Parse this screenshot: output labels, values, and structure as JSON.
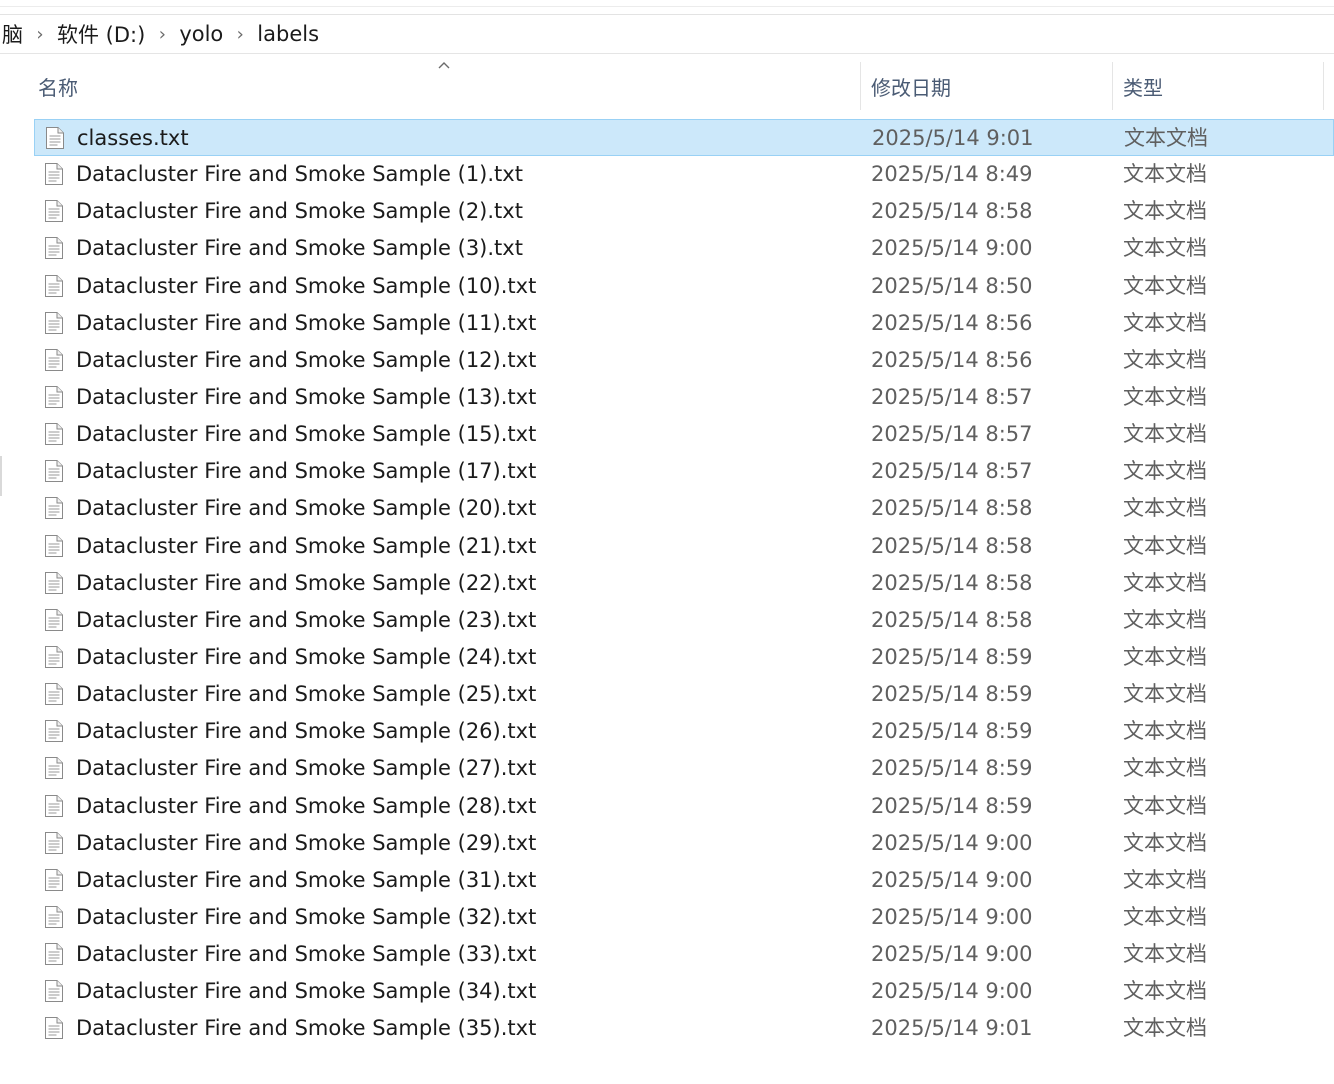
{
  "breadcrumb": {
    "items": [
      "脑",
      "软件 (D:)",
      "yolo",
      "labels"
    ],
    "separator_icon": "chevron-right-icon"
  },
  "columns": {
    "name": "名称",
    "date": "修改日期",
    "type": "类型",
    "sort_indicator": "sort-ascending-icon"
  },
  "files": [
    {
      "name": "classes.txt",
      "date": "2025/5/14 9:01",
      "type": "文本文档",
      "selected": true
    },
    {
      "name": "Datacluster Fire and Smoke Sample (1).txt",
      "date": "2025/5/14 8:49",
      "type": "文本文档"
    },
    {
      "name": "Datacluster Fire and Smoke Sample (2).txt",
      "date": "2025/5/14 8:58",
      "type": "文本文档"
    },
    {
      "name": "Datacluster Fire and Smoke Sample (3).txt",
      "date": "2025/5/14 9:00",
      "type": "文本文档"
    },
    {
      "name": "Datacluster Fire and Smoke Sample (10).txt",
      "date": "2025/5/14 8:50",
      "type": "文本文档"
    },
    {
      "name": "Datacluster Fire and Smoke Sample (11).txt",
      "date": "2025/5/14 8:56",
      "type": "文本文档"
    },
    {
      "name": "Datacluster Fire and Smoke Sample (12).txt",
      "date": "2025/5/14 8:56",
      "type": "文本文档"
    },
    {
      "name": "Datacluster Fire and Smoke Sample (13).txt",
      "date": "2025/5/14 8:57",
      "type": "文本文档"
    },
    {
      "name": "Datacluster Fire and Smoke Sample (15).txt",
      "date": "2025/5/14 8:57",
      "type": "文本文档"
    },
    {
      "name": "Datacluster Fire and Smoke Sample (17).txt",
      "date": "2025/5/14 8:57",
      "type": "文本文档"
    },
    {
      "name": "Datacluster Fire and Smoke Sample (20).txt",
      "date": "2025/5/14 8:58",
      "type": "文本文档"
    },
    {
      "name": "Datacluster Fire and Smoke Sample (21).txt",
      "date": "2025/5/14 8:58",
      "type": "文本文档"
    },
    {
      "name": "Datacluster Fire and Smoke Sample (22).txt",
      "date": "2025/5/14 8:58",
      "type": "文本文档"
    },
    {
      "name": "Datacluster Fire and Smoke Sample (23).txt",
      "date": "2025/5/14 8:58",
      "type": "文本文档"
    },
    {
      "name": "Datacluster Fire and Smoke Sample (24).txt",
      "date": "2025/5/14 8:59",
      "type": "文本文档"
    },
    {
      "name": "Datacluster Fire and Smoke Sample (25).txt",
      "date": "2025/5/14 8:59",
      "type": "文本文档"
    },
    {
      "name": "Datacluster Fire and Smoke Sample (26).txt",
      "date": "2025/5/14 8:59",
      "type": "文本文档"
    },
    {
      "name": "Datacluster Fire and Smoke Sample (27).txt",
      "date": "2025/5/14 8:59",
      "type": "文本文档"
    },
    {
      "name": "Datacluster Fire and Smoke Sample (28).txt",
      "date": "2025/5/14 8:59",
      "type": "文本文档"
    },
    {
      "name": "Datacluster Fire and Smoke Sample (29).txt",
      "date": "2025/5/14 9:00",
      "type": "文本文档"
    },
    {
      "name": "Datacluster Fire and Smoke Sample (31).txt",
      "date": "2025/5/14 9:00",
      "type": "文本文档"
    },
    {
      "name": "Datacluster Fire and Smoke Sample (32).txt",
      "date": "2025/5/14 9:00",
      "type": "文本文档"
    },
    {
      "name": "Datacluster Fire and Smoke Sample (33).txt",
      "date": "2025/5/14 9:00",
      "type": "文本文档"
    },
    {
      "name": "Datacluster Fire and Smoke Sample (34).txt",
      "date": "2025/5/14 9:00",
      "type": "文本文档"
    },
    {
      "name": "Datacluster Fire and Smoke Sample (35).txt",
      "date": "2025/5/14 9:01",
      "type": "文本文档"
    }
  ],
  "file_icon": "text-file-icon",
  "colors": {
    "selection_bg": "#cce8fa",
    "selection_border": "#99d1f5",
    "header_text": "#4a5b74",
    "secondary_text": "#5f5f5f"
  }
}
